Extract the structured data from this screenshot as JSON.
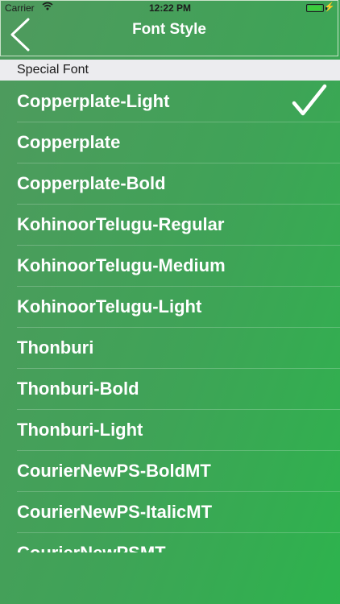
{
  "status_bar": {
    "carrier": "Carrier",
    "time": "12:22 PM",
    "battery_level": 0.95
  },
  "nav": {
    "title": "Font Style",
    "back_icon": "chevron-left-icon"
  },
  "section": {
    "header": "Special Font"
  },
  "fonts": [
    {
      "label": "Copperplate-Light",
      "selected": true
    },
    {
      "label": "Copperplate",
      "selected": false
    },
    {
      "label": "Copperplate-Bold",
      "selected": false
    },
    {
      "label": "KohinoorTelugu-Regular",
      "selected": false
    },
    {
      "label": "KohinoorTelugu-Medium",
      "selected": false
    },
    {
      "label": "KohinoorTelugu-Light",
      "selected": false
    },
    {
      "label": "Thonburi",
      "selected": false
    },
    {
      "label": "Thonburi-Bold",
      "selected": false
    },
    {
      "label": "Thonburi-Light",
      "selected": false
    },
    {
      "label": "CourierNewPS-BoldMT",
      "selected": false
    },
    {
      "label": "CourierNewPS-ItalicMT",
      "selected": false
    },
    {
      "label": "CourierNewPSMT",
      "selected": false
    }
  ],
  "colors": {
    "accent": "#2db34d",
    "header_bg": "#ececef"
  }
}
